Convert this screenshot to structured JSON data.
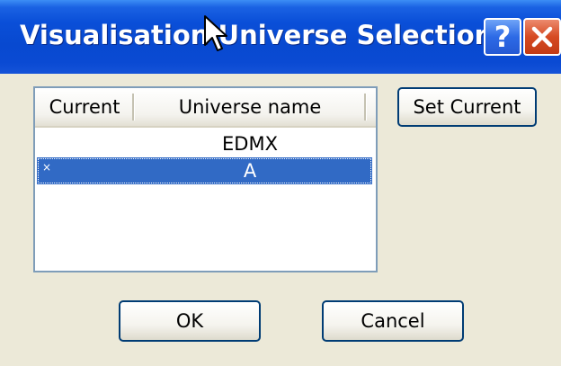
{
  "window": {
    "title": "Visualisation Universe Selection",
    "help_label": "?",
    "close_label": "×"
  },
  "list": {
    "columns": [
      "Current",
      "Universe name"
    ],
    "rows": [
      {
        "current": "",
        "name": "EDMX",
        "selected": false
      },
      {
        "current": "×",
        "name": "A",
        "selected": true
      }
    ]
  },
  "buttons": {
    "set_current": "Set Current",
    "ok": "OK",
    "cancel": "Cancel"
  },
  "colors": {
    "titlebar": "#0a4fd8",
    "selection": "#316ac5",
    "close": "#d64a22",
    "dialog_bg": "#ece9d8"
  }
}
